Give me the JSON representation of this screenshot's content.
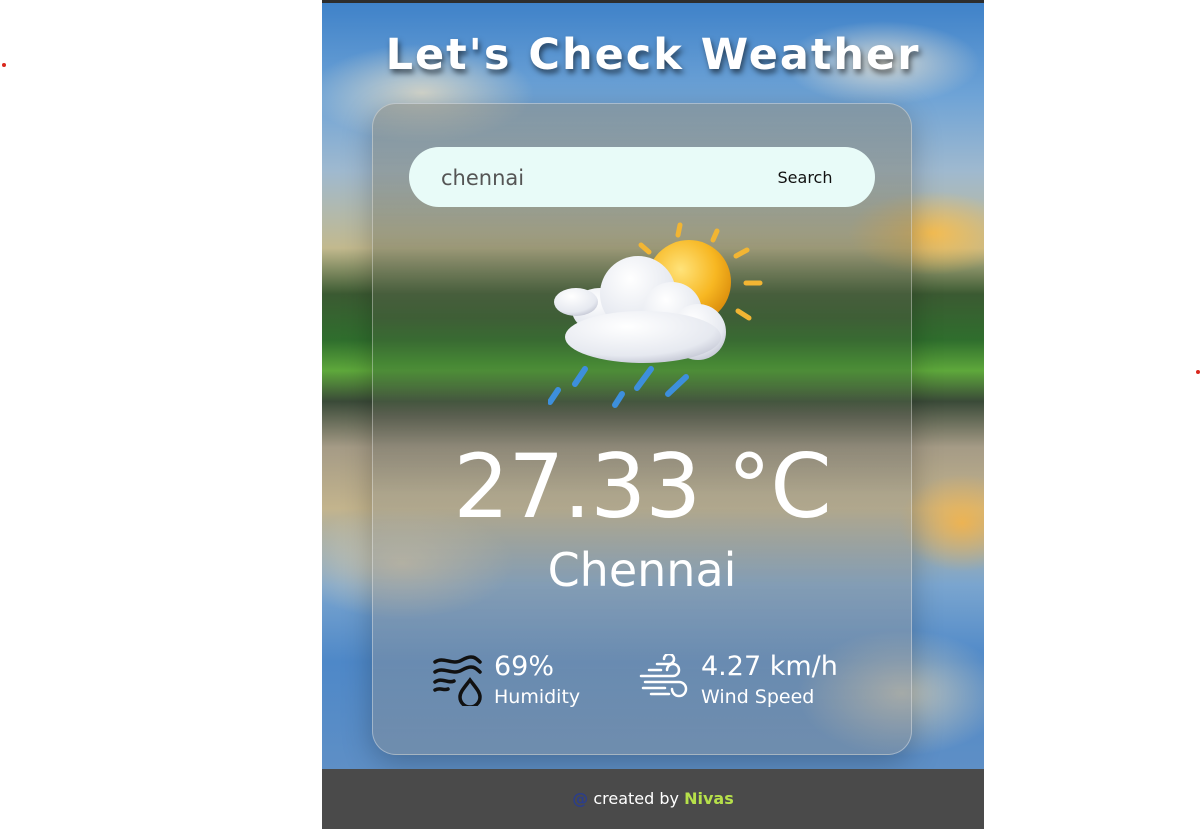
{
  "app": {
    "title": "Let's Check Weather"
  },
  "search": {
    "value": "chennai",
    "placeholder": "Enter city name",
    "button_label": "Search"
  },
  "weather": {
    "icon": "cloud-sun-rain-icon",
    "temperature": "27.33 °C",
    "city": "Chennai"
  },
  "details": {
    "humidity": {
      "value": "69%",
      "label": "Humidity",
      "icon": "humidity-icon"
    },
    "wind": {
      "value": "4.27 km/h",
      "label": "Wind Speed",
      "icon": "wind-icon"
    }
  },
  "footer": {
    "at_symbol": "@",
    "text": "created by",
    "author": "Nivas"
  },
  "colors": {
    "search_bg": "#e8fbf8",
    "footer_bg": "#4a4a4a",
    "author": "#b6e04a",
    "at_symbol": "#2c3e8a"
  }
}
